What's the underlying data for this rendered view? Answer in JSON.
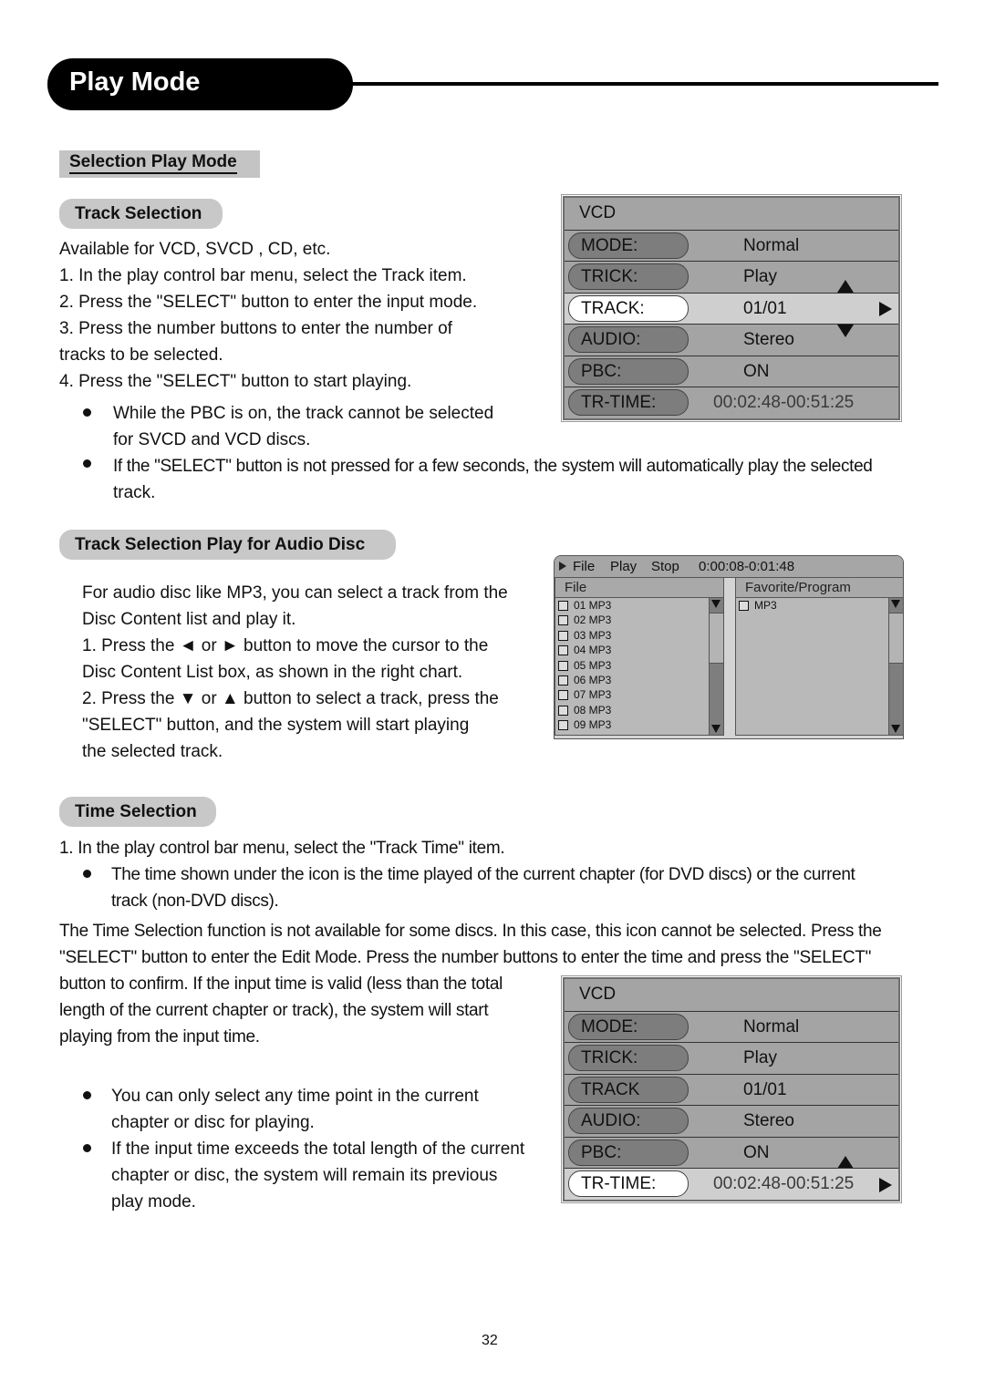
{
  "header": {
    "title": "Play Mode"
  },
  "section": {
    "title": "Selection Play Mode"
  },
  "track_selection": {
    "heading": "Track Selection",
    "lines": [
      "Available for VCD, SVCD , CD, etc.",
      "1. In the play control bar menu, select the Track item.",
      "2. Press the \"SELECT\" button to enter the input mode.",
      "3. Press the number buttons to enter the number of",
      "tracks to be selected.",
      "4. Press the \"SELECT\" button to start playing."
    ],
    "bullets": [
      {
        "line1": "While the PBC is on, the track cannot be selected",
        "line2": "for SVCD and VCD discs."
      },
      {
        "line1": "If the \"SELECT\" button is not pressed for a few seconds, the system will automatically play the selected",
        "line2": "track."
      }
    ]
  },
  "vcd_menu_1": {
    "header": "VCD",
    "rows": [
      {
        "label": "MODE:",
        "value": "Normal"
      },
      {
        "label": "TRICK:",
        "value": "Play"
      },
      {
        "label": "TRACK:",
        "value": "01/01",
        "selected": true
      },
      {
        "label": "AUDIO:",
        "value": "Stereo"
      },
      {
        "label": "PBC:",
        "value": "ON"
      },
      {
        "label": "TR-TIME:",
        "value": "00:02:48-00:51:25"
      }
    ]
  },
  "audio_disc": {
    "heading": "Track Selection Play for Audio Disc",
    "lines": [
      "For audio disc like MP3, you can select a track from the",
      "Disc Content list and play it.",
      "1. Press the ◄ or ► button to move the cursor to the",
      "Disc Content List box, as shown in the right chart.",
      "2. Press the ▼ or ▲ button to select a track, press the",
      "\"SELECT\" button, and the system will start playing",
      "the selected track."
    ]
  },
  "file_browser": {
    "top_bar": {
      "file": "File",
      "play": "Play",
      "stop": "Stop",
      "time": "0:00:08-0:01:48"
    },
    "left_pane": {
      "header": "File",
      "items": [
        "01 MP3",
        "02 MP3",
        "03 MP3",
        "04 MP3",
        "05 MP3",
        "06 MP3",
        "07 MP3",
        "08 MP3",
        "09 MP3"
      ]
    },
    "right_pane": {
      "header": "Favorite/Program",
      "items": [
        "MP3"
      ]
    }
  },
  "time_selection": {
    "heading": "Time Selection",
    "step1": "1. In the play control bar menu, select the \"Track Time\" item.",
    "step1_bullet": {
      "line1": "The time shown under the icon is the time played of the current chapter (for DVD discs) or the current",
      "line2": "track (non-DVD discs)."
    },
    "para": [
      "The Time Selection function is not available for some discs. In this case, this icon cannot be selected. Press the",
      "\"SELECT\" button to enter the Edit Mode. Press the number buttons to enter the time and press the \"SELECT\"",
      "button to confirm. If the input time is valid (less than the total",
      "length of the current chapter or track), the system will start",
      "playing from the input time."
    ],
    "bullets": [
      {
        "lines": [
          "You can only select any time point in the current",
          "chapter or disc for playing."
        ]
      },
      {
        "lines": [
          "If the input time exceeds the total length of the current",
          "chapter or disc, the system will remain its previous",
          "play mode."
        ]
      }
    ]
  },
  "vcd_menu_2": {
    "header": "VCD",
    "rows": [
      {
        "label": "MODE:",
        "value": "Normal"
      },
      {
        "label": "TRICK:",
        "value": "Play"
      },
      {
        "label": "TRACK",
        "value": "01/01"
      },
      {
        "label": "AUDIO:",
        "value": "Stereo"
      },
      {
        "label": "PBC:",
        "value": "ON"
      },
      {
        "label": "TR-TIME:",
        "value": "00:02:48-00:51:25",
        "selected": true
      }
    ]
  },
  "footer": {
    "page_number": "32"
  }
}
